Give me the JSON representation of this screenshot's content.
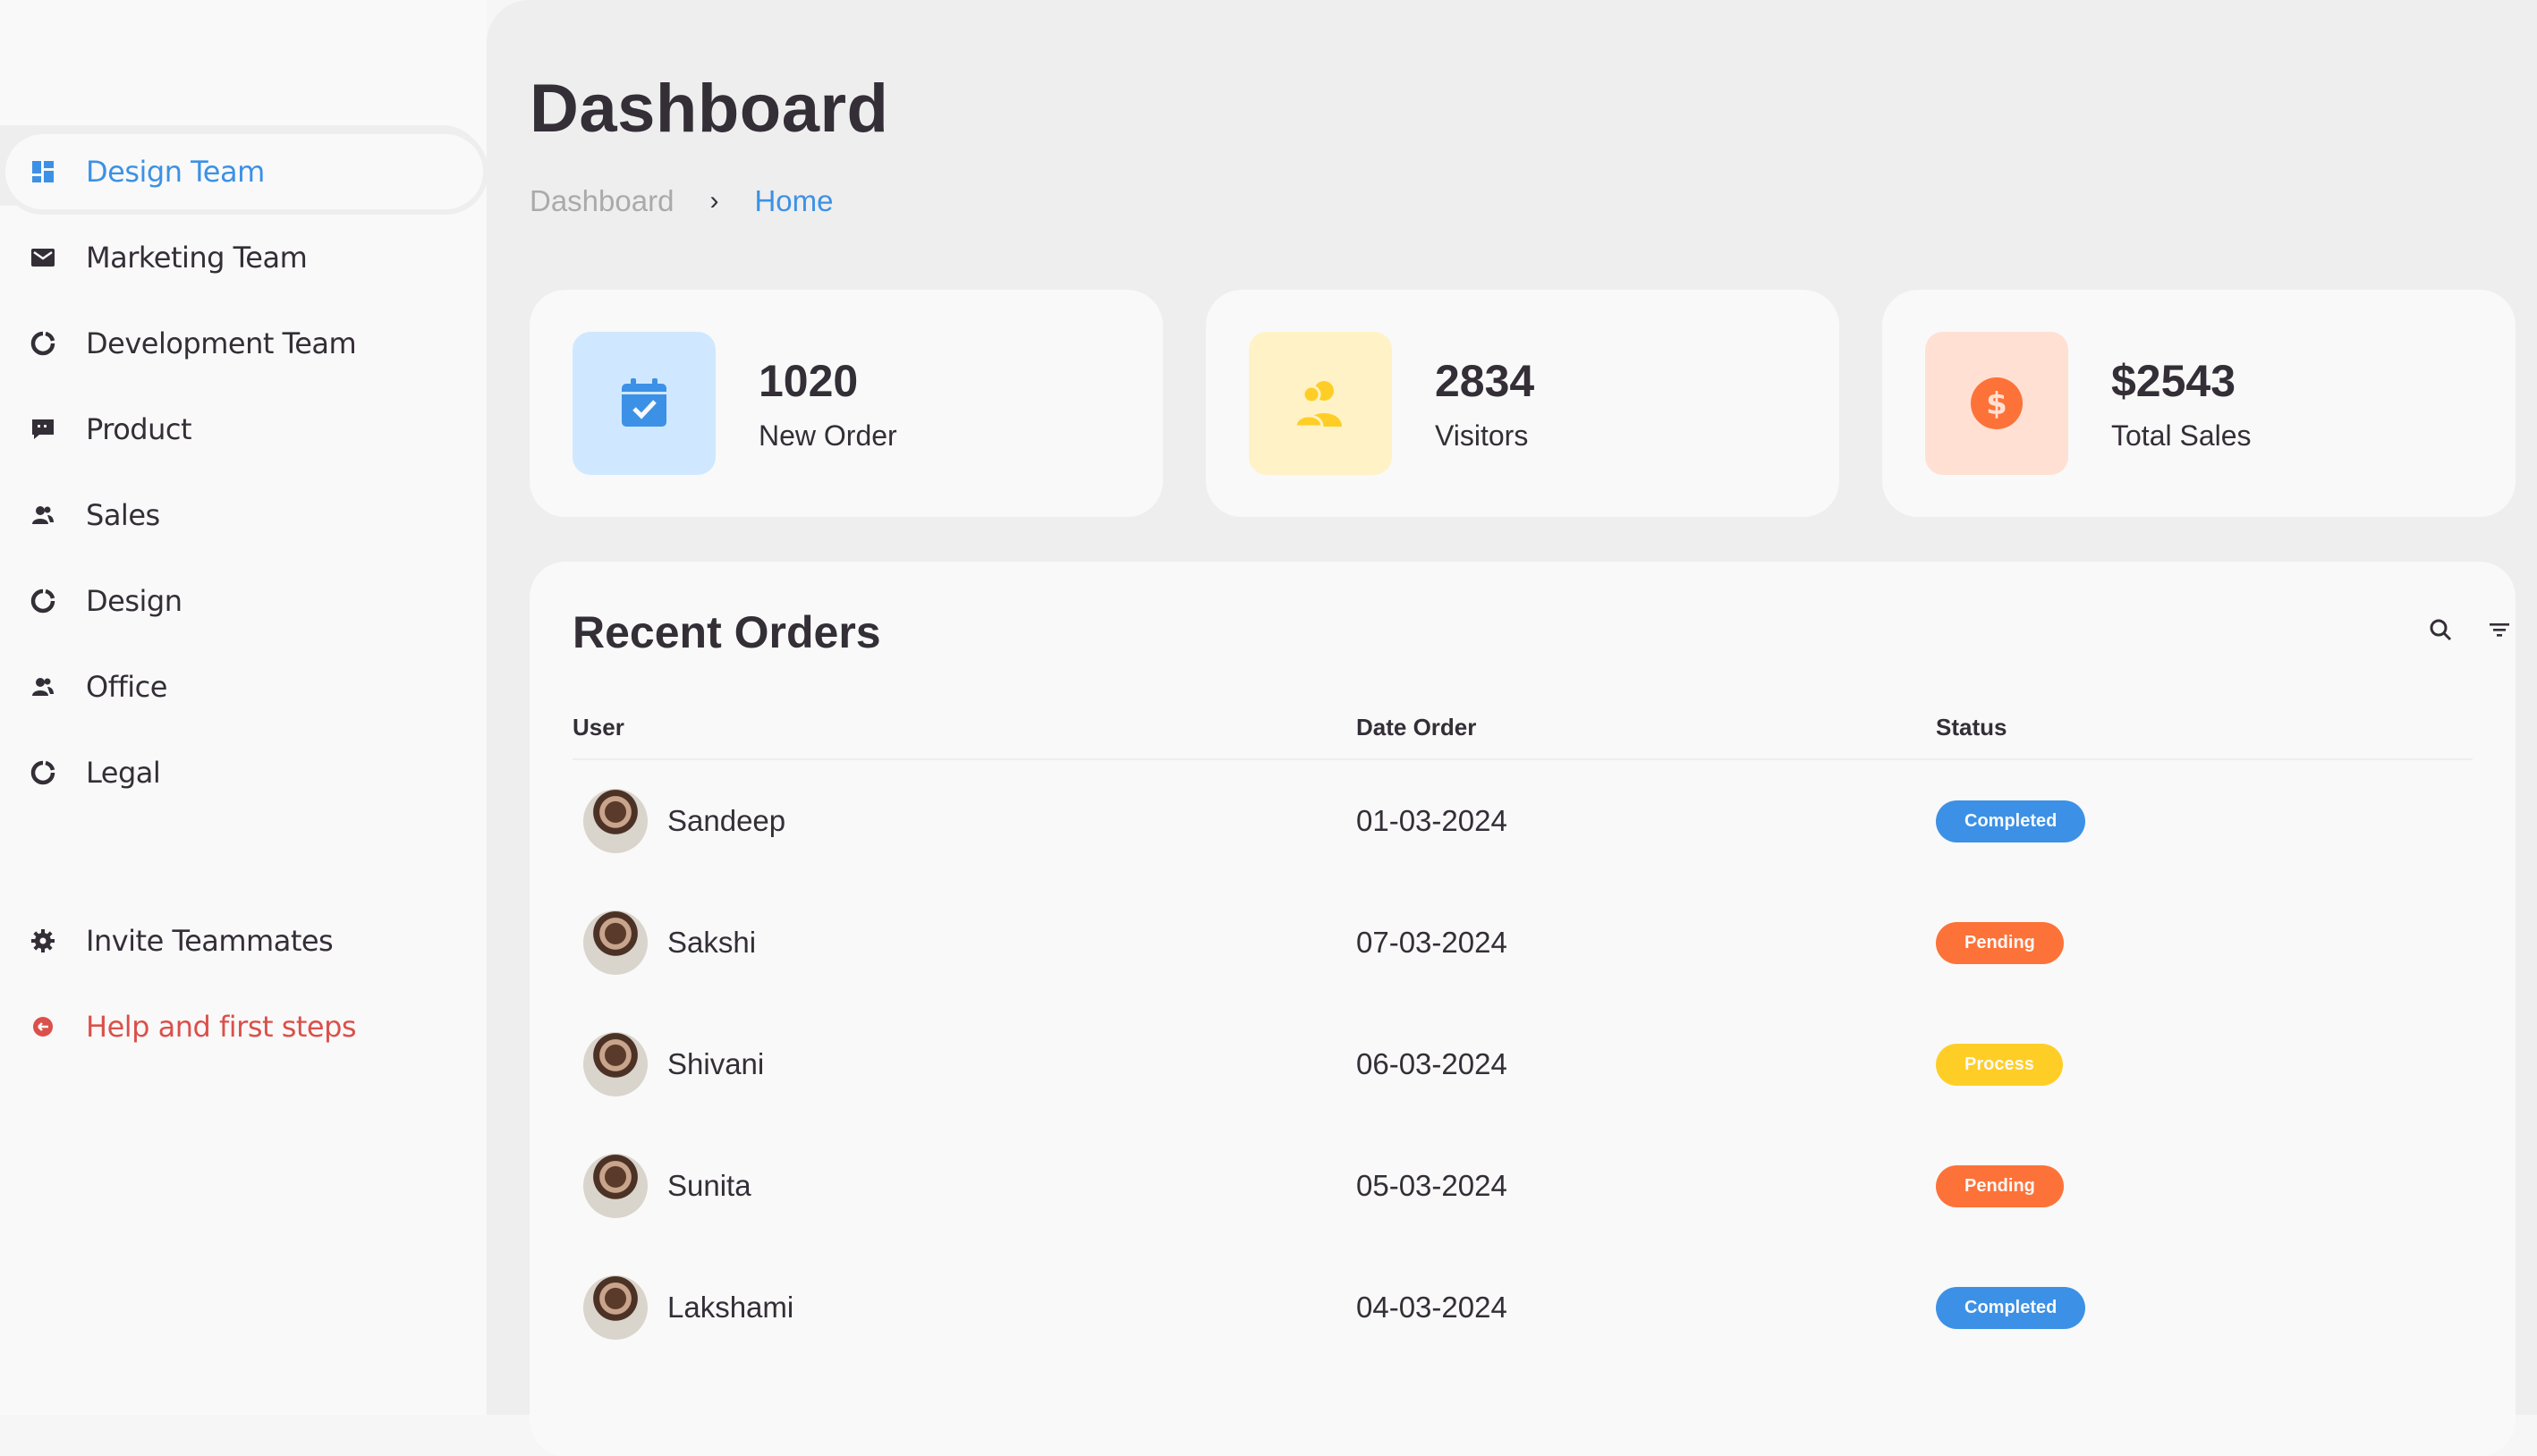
{
  "sidebar": {
    "items": [
      {
        "label": "Design Team",
        "icon": "dashboard-icon"
      },
      {
        "label": "Marketing Team",
        "icon": "store-icon"
      },
      {
        "label": "Development Team",
        "icon": "doughnut-chart-icon"
      },
      {
        "label": "Product",
        "icon": "message-icon"
      },
      {
        "label": "Sales",
        "icon": "group-icon"
      },
      {
        "label": "Design",
        "icon": "doughnut-chart-icon"
      },
      {
        "label": "Office",
        "icon": "group-icon"
      },
      {
        "label": "Legal",
        "icon": "doughnut-chart-icon"
      }
    ],
    "bottom": [
      {
        "label": "Invite Teammates",
        "icon": "cog-icon"
      },
      {
        "label": "Help and first steps",
        "icon": "logout-icon"
      }
    ]
  },
  "header": {
    "title": "Dashboard",
    "breadcrumb": [
      "Dashboard",
      "Home"
    ],
    "breadcrumb_separator": "›"
  },
  "cards": [
    {
      "value": "1020",
      "label": "New Order",
      "icon": "calendar-check-icon",
      "bg": "#cfe8ff",
      "fg": "#3c91e6"
    },
    {
      "value": "2834",
      "label": "Visitors",
      "icon": "group-icon",
      "bg": "#fff2c6",
      "fg": "#ffce26"
    },
    {
      "value": "$2543",
      "label": "Total Sales",
      "icon": "dollar-circle-icon",
      "bg": "#ffe0d3",
      "fg": "#fd7238"
    }
  ],
  "orders": {
    "title": "Recent Orders",
    "columns": [
      "User",
      "Date Order",
      "Status"
    ],
    "rows": [
      {
        "user": "Sandeep",
        "date": "01-03-2024",
        "status": "Completed",
        "status_type": "completed"
      },
      {
        "user": "Sakshi",
        "date": "07-03-2024",
        "status": "Pending",
        "status_type": "pending"
      },
      {
        "user": "Shivani",
        "date": "06-03-2024",
        "status": "Process",
        "status_type": "process"
      },
      {
        "user": "Sunita",
        "date": "05-03-2024",
        "status": "Pending",
        "status_type": "pending"
      },
      {
        "user": "Lakshami",
        "date": "04-03-2024",
        "status": "Completed",
        "status_type": "completed"
      }
    ]
  },
  "colors": {
    "accent": "#3c91e6",
    "danger": "#db504a",
    "text": "#342e37",
    "muted": "#aaaaaa"
  }
}
